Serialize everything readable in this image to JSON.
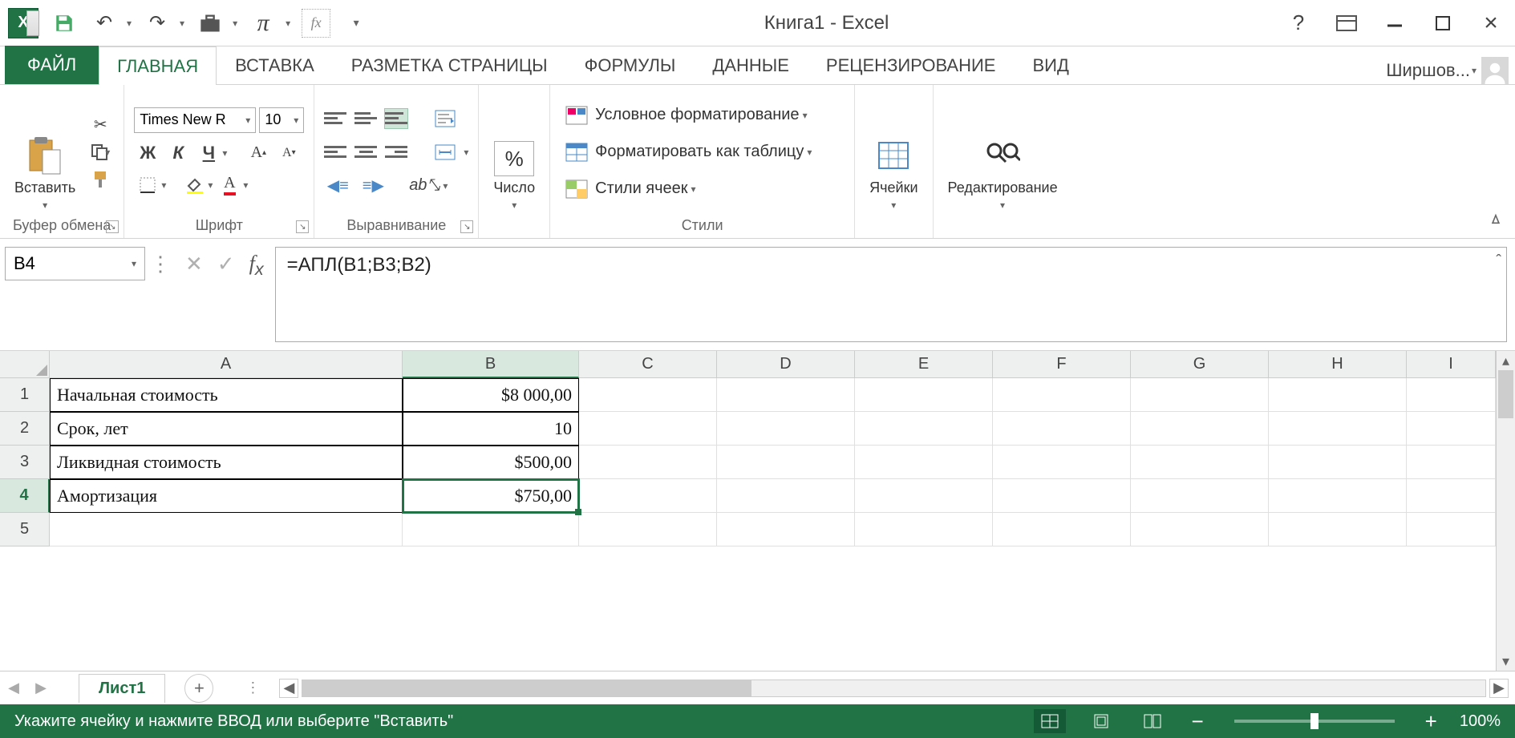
{
  "window": {
    "title": "Книга1 - Excel"
  },
  "qat": {
    "undo": "↶",
    "redo": "↷"
  },
  "tabs": {
    "file": "ФАЙЛ",
    "items": [
      "ГЛАВНАЯ",
      "ВСТАВКА",
      "РАЗМЕТКА СТРАНИЦЫ",
      "ФОРМУЛЫ",
      "ДАННЫЕ",
      "РЕЦЕНЗИРОВАНИЕ",
      "ВИД"
    ],
    "active": 0,
    "user": "Ширшов..."
  },
  "ribbon": {
    "clipboard": {
      "paste": "Вставить",
      "label": "Буфер обмена"
    },
    "font": {
      "name": "Times New R",
      "size": "10",
      "label": "Шрифт"
    },
    "alignment": {
      "label": "Выравнивание"
    },
    "number": {
      "btn": "%",
      "label": "Число"
    },
    "styles": {
      "cond": "Условное форматирование",
      "table": "Форматировать как таблицу",
      "cell": "Стили ячеек",
      "label": "Стили"
    },
    "cells": {
      "label": "Ячейки"
    },
    "editing": {
      "label": "Редактирование"
    }
  },
  "fx": {
    "namebox": "B4",
    "formula": "=АПЛ(B1;B3;B2)"
  },
  "grid": {
    "cols": [
      "A",
      "B",
      "C",
      "D",
      "E",
      "F",
      "G",
      "H",
      "I"
    ],
    "selectedRow": 4,
    "selectedCol": "B",
    "rows": [
      {
        "n": 1,
        "A": "Начальная стоимость",
        "B": "$8 000,00"
      },
      {
        "n": 2,
        "A": "Срок, лет",
        "B": "10"
      },
      {
        "n": 3,
        "A": "Ликвидная стоимость",
        "B": "$500,00"
      },
      {
        "n": 4,
        "A": "Амортизация",
        "B": "$750,00"
      },
      {
        "n": 5,
        "A": "",
        "B": ""
      }
    ]
  },
  "sheets": {
    "active": "Лист1"
  },
  "status": {
    "msg": "Укажите ячейку и нажмите ВВОД или выберите \"Вставить\"",
    "zoom": "100%"
  }
}
